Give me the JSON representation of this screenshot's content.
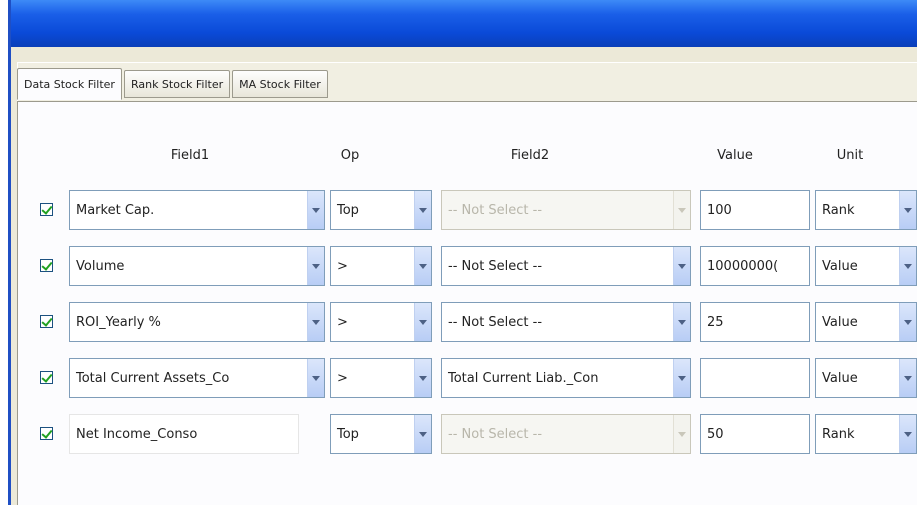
{
  "tabs": [
    "Data Stock Filter",
    "Rank Stock Filter",
    "MA Stock Filter"
  ],
  "headers": {
    "field1": "Field1",
    "op": "Op",
    "field2": "Field2",
    "value": "Value",
    "unit": "Unit"
  },
  "rows": [
    {
      "checked": true,
      "field1": "Market Cap.",
      "op": "Top",
      "field2": "-- Not Select --",
      "field2_disabled": true,
      "value": "100",
      "unit": "Rank"
    },
    {
      "checked": true,
      "field1": "Volume",
      "op": ">",
      "field2": "-- Not Select --",
      "field2_disabled": false,
      "value": "10000000(",
      "unit": "Value"
    },
    {
      "checked": true,
      "field1": "ROI_Yearly %",
      "op": ">",
      "field2": "-- Not Select --",
      "field2_disabled": false,
      "value": "25",
      "unit": "Value"
    },
    {
      "checked": true,
      "field1": "Total Current Assets_Co",
      "op": ">",
      "field2": "Total Current Liab._Con",
      "field2_disabled": false,
      "value": "",
      "unit": "Value"
    },
    {
      "checked": true,
      "field1": "Net Income_Conso",
      "op": "Top",
      "field2": "-- Not Select --",
      "field2_disabled": true,
      "value": "50",
      "unit": "Rank"
    }
  ],
  "colors": {
    "titlebar": "#0a4ad8",
    "window_bg": "#ece9d8",
    "check": "#21a121",
    "input_border": "#7f9db9"
  }
}
